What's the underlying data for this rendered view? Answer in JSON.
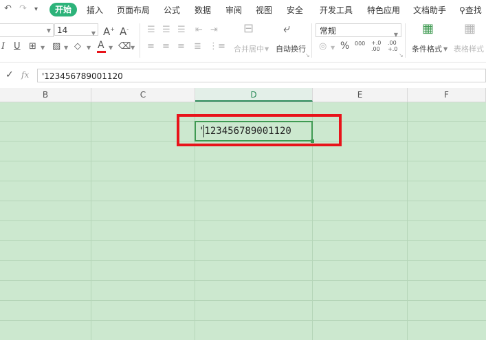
{
  "menubar": {
    "tabs": [
      "开始",
      "插入",
      "页面布局",
      "公式",
      "数据",
      "审阅",
      "视图",
      "安全",
      "开发工具",
      "特色应用",
      "文档助手"
    ],
    "search_label": "查找"
  },
  "ribbon": {
    "font_size": "14",
    "merge_center_label": "合并居中",
    "wrap_text_label": "自动换行",
    "number_format": "常规",
    "conditional_format_label": "条件格式",
    "table_style_label": "表格样式",
    "percent_symbol": "%",
    "thousands_symbol": "000",
    "inc_decimal_label": "+.0 .00",
    "dec_decimal_label": ".00 +.0"
  },
  "formula_bar": {
    "fx_label": "fx",
    "value": "'123456789001120"
  },
  "columns": [
    "B",
    "C",
    "D",
    "E",
    "F"
  ],
  "active_cell": {
    "column": "D",
    "content": "'123456789001120"
  },
  "colors": {
    "accent": "#2db37a",
    "sheet_background": "#cce8cf",
    "highlight": "#e8131a",
    "font_color_bar": "#e8131a"
  }
}
